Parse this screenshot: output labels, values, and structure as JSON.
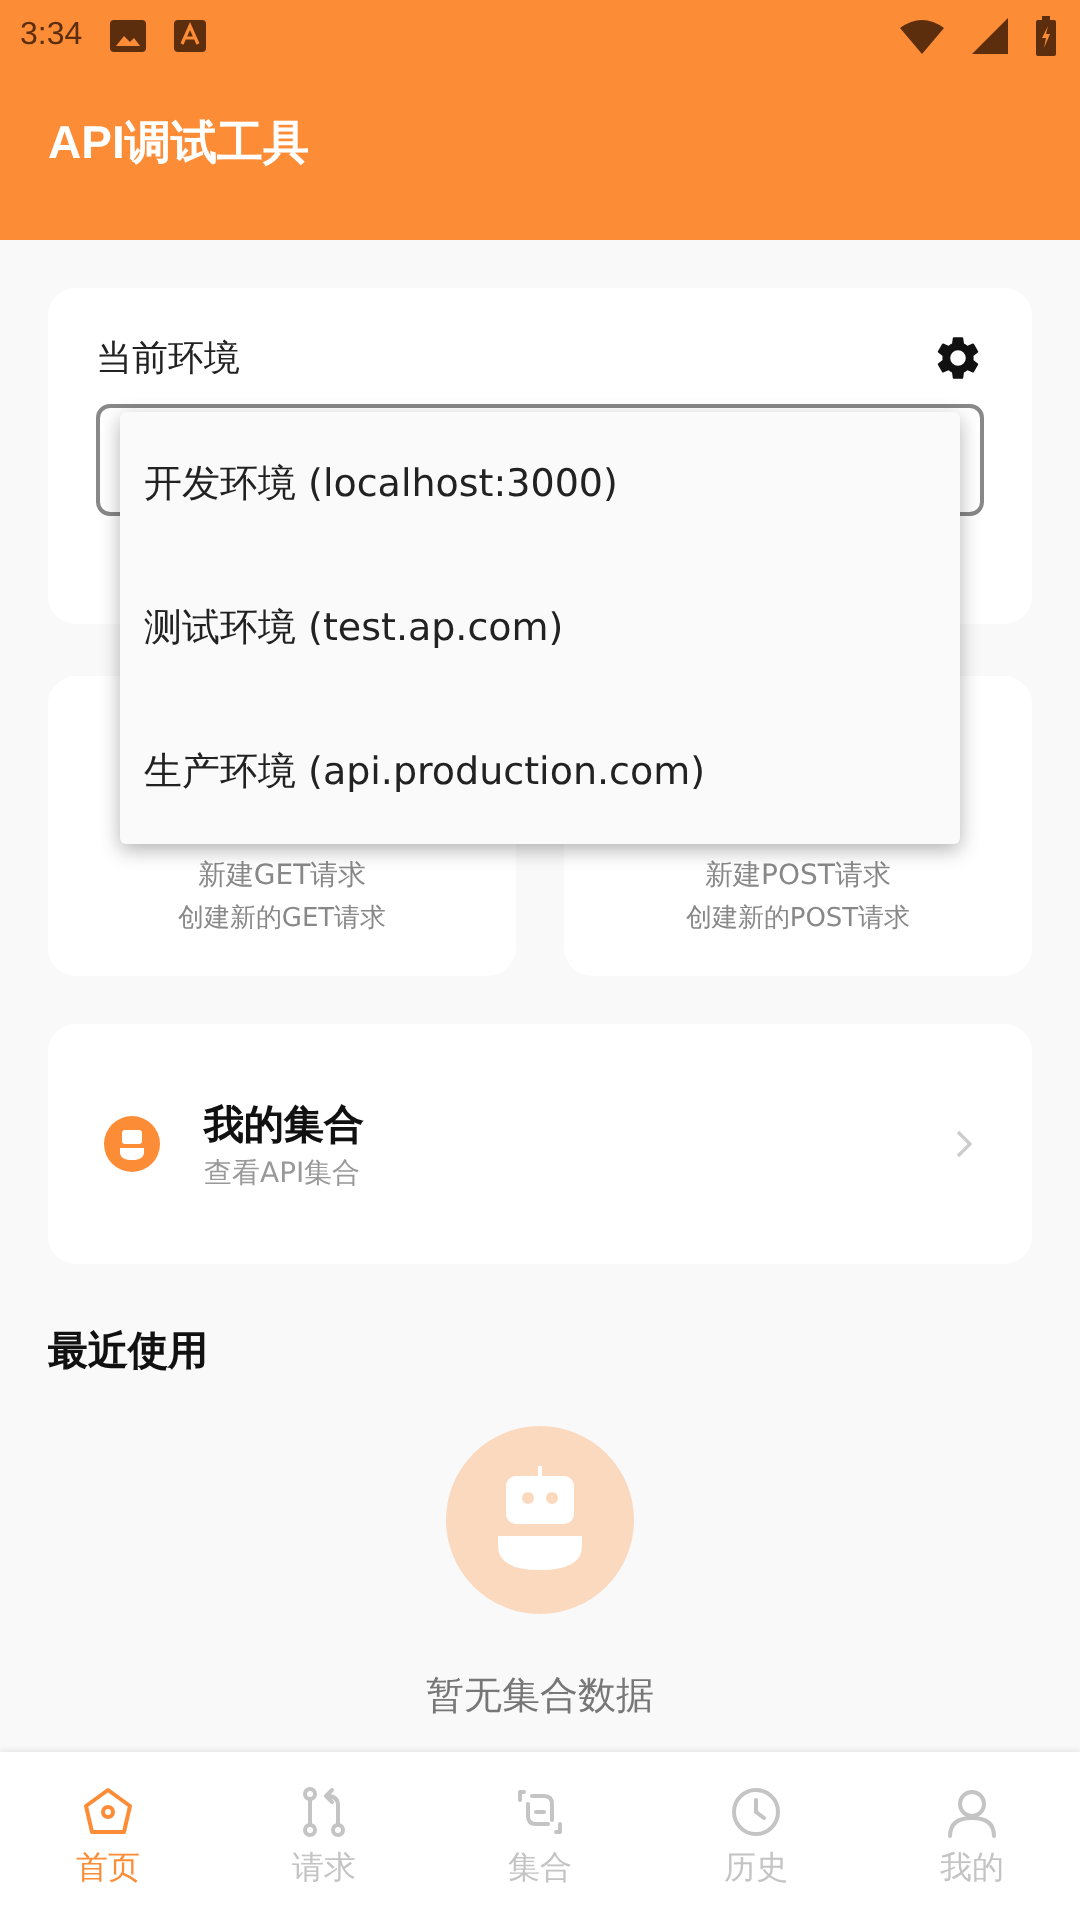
{
  "status_bar": {
    "time": "3:34"
  },
  "app_bar": {
    "title": "API调试工具"
  },
  "environment": {
    "label": "当前环境",
    "menu_open": true,
    "options": [
      {
        "label": "开发环境 (localhost:3000)"
      },
      {
        "label": "测试环境 (test.ap.com)"
      },
      {
        "label": "生产环境 (api.production.com)"
      }
    ]
  },
  "quick_actions": [
    {
      "title": "新建GET请求",
      "subtitle": "创建新的GET请求"
    },
    {
      "title": "新建POST请求",
      "subtitle": "创建新的POST请求"
    }
  ],
  "collection": {
    "title": "我的集合",
    "subtitle": "查看API集合"
  },
  "recent": {
    "heading": "最近使用",
    "empty_text": "暂无集合数据"
  },
  "tabs": [
    {
      "kind": "home",
      "label": "首页",
      "selected": true
    },
    {
      "kind": "request",
      "label": "请求",
      "selected": false
    },
    {
      "kind": "collection",
      "label": "集合",
      "selected": false
    },
    {
      "kind": "history",
      "label": "历史",
      "selected": false
    },
    {
      "kind": "profile",
      "label": "我的",
      "selected": false
    }
  ]
}
